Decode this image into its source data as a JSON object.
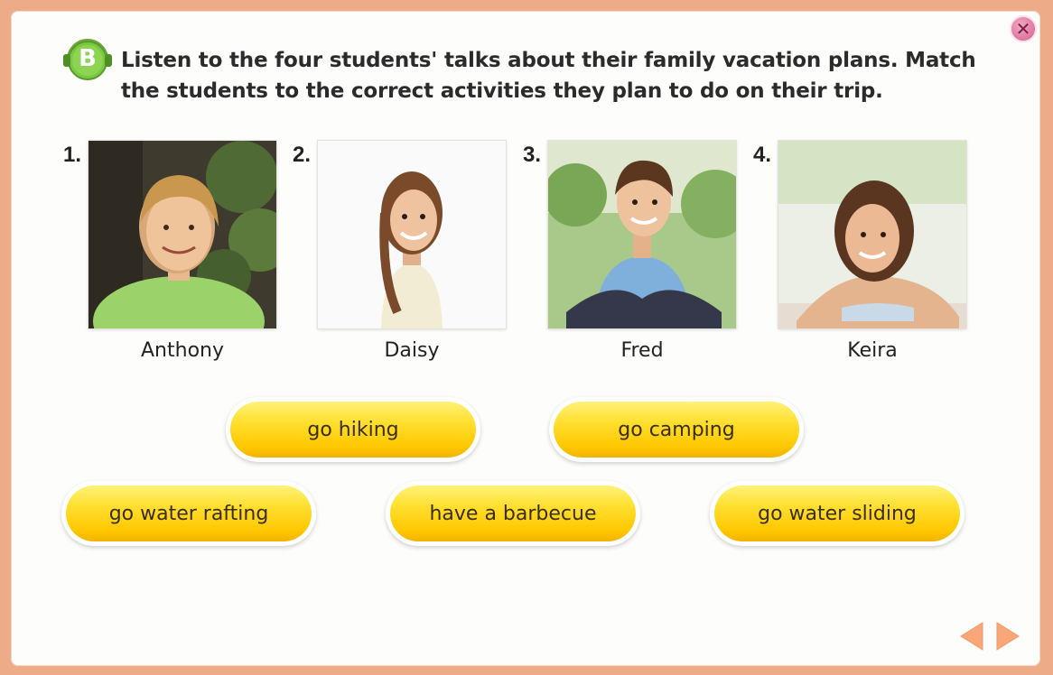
{
  "header": {
    "badge_letter": "B",
    "instruction": "Listen to the four students' talks about their family vacation plans. Match the students to the correct activities they plan to do on their trip."
  },
  "students": [
    {
      "number": "1.",
      "name": "Anthony"
    },
    {
      "number": "2.",
      "name": "Daisy"
    },
    {
      "number": "3.",
      "name": "Fred"
    },
    {
      "number": "4.",
      "name": "Keira"
    }
  ],
  "activities": [
    {
      "label": "go hiking"
    },
    {
      "label": "go camping"
    },
    {
      "label": "go water rafting"
    },
    {
      "label": "have a barbecue"
    },
    {
      "label": "go water sliding"
    }
  ],
  "controls": {
    "close_glyph": "✕"
  },
  "colors": {
    "frame": "#eeab88",
    "pill_yellow": "#ffd21a",
    "arrow": "#f7a77a",
    "badge_green": "#7ac943",
    "close_pink": "#e07aa2"
  },
  "icons": [
    "close-icon",
    "headphones-badge-icon",
    "arrow-left-icon",
    "arrow-right-icon"
  ]
}
